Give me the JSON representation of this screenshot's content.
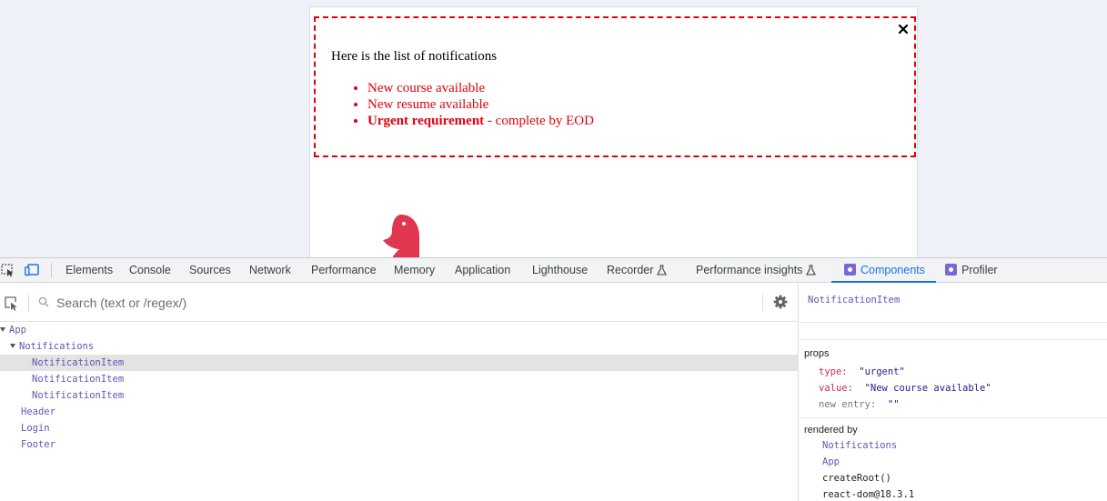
{
  "notifications": {
    "title": "Here is the list of notifications",
    "items": [
      {
        "text": "New course available"
      },
      {
        "text": "New resume available"
      },
      {
        "bold": "Urgent requirement",
        "rest": " - complete by EOD"
      }
    ],
    "close_icon": "close-icon",
    "accent_color": "#e0000f"
  },
  "devtools": {
    "tabs": [
      "Elements",
      "Console",
      "Sources",
      "Network",
      "Performance",
      "Memory",
      "Application",
      "Lighthouse",
      "Recorder",
      "Performance insights",
      "Components",
      "Profiler"
    ],
    "active_tab": "Components",
    "active_color": "#1a73e8",
    "search": {
      "placeholder": "Search (text or /regex/)"
    },
    "tree": [
      {
        "label": "App",
        "expanded": true
      },
      {
        "label": "Notifications",
        "expanded": true
      },
      {
        "label": "NotificationItem",
        "selected": true
      },
      {
        "label": "NotificationItem"
      },
      {
        "label": "NotificationItem"
      },
      {
        "label": "Header"
      },
      {
        "label": "Login"
      },
      {
        "label": "Footer"
      }
    ],
    "inspected": {
      "name": "NotificationItem",
      "props_label": "props",
      "props": [
        {
          "key": "type",
          "value": "\"urgent\""
        },
        {
          "key": "value",
          "value": "\"New course available\""
        },
        {
          "key": "new entry",
          "value": "\"\""
        }
      ],
      "rendered_by_label": "rendered by",
      "rendered_by": [
        "Notifications",
        "App",
        "createRoot()",
        "react-dom@18.3.1"
      ]
    }
  }
}
